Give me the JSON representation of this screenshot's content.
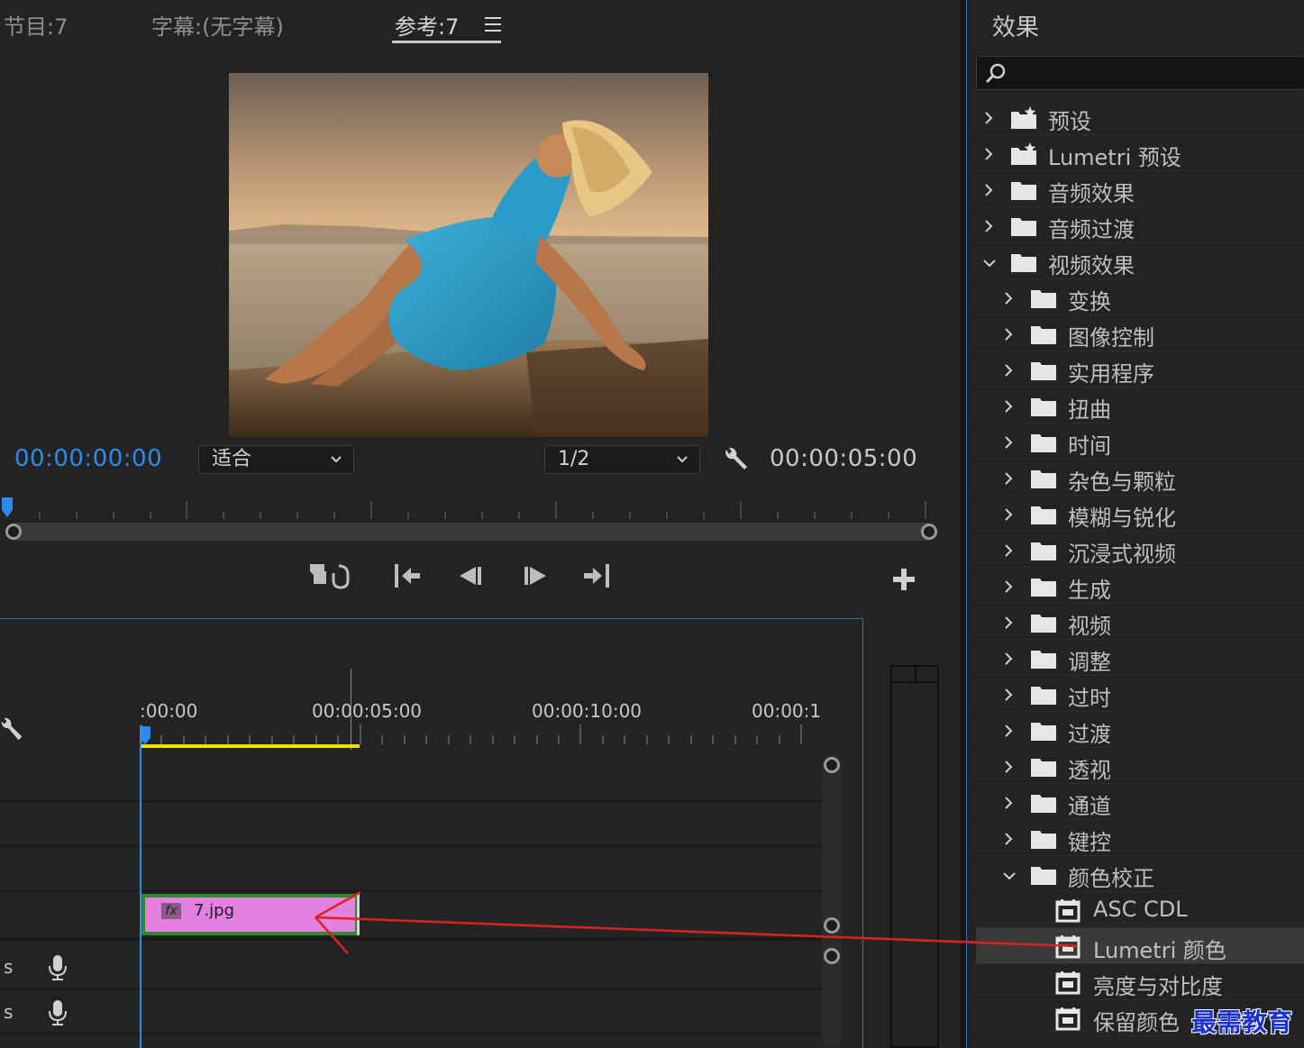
{
  "monitor": {
    "tabs": [
      {
        "label": "节目:7"
      },
      {
        "label": "字幕:(无字幕)"
      },
      {
        "label": "参考:7"
      }
    ],
    "timecode_current": "00:00:00:00",
    "timecode_duration": "00:00:05:00",
    "zoom_select": "适合",
    "resolution_select": "1/2"
  },
  "timeline": {
    "ruler_labels": [
      ":00:00",
      "00:00:05:00",
      "00:00:10:00",
      "00:00:1!"
    ],
    "clip": {
      "fx_badge": "fx",
      "name": "7.jpg"
    },
    "audio_labels": [
      "s",
      "s"
    ]
  },
  "effects": {
    "title": "效果",
    "search_placeholder": "",
    "items": [
      {
        "label": "预设",
        "level": 0,
        "type": "preset-folder",
        "expanded": false
      },
      {
        "label": "Lumetri 预设",
        "level": 0,
        "type": "preset-folder",
        "expanded": false
      },
      {
        "label": "音频效果",
        "level": 0,
        "type": "folder",
        "expanded": false
      },
      {
        "label": "音频过渡",
        "level": 0,
        "type": "folder",
        "expanded": false
      },
      {
        "label": "视频效果",
        "level": 0,
        "type": "folder",
        "expanded": true
      },
      {
        "label": "变换",
        "level": 1,
        "type": "folder",
        "expanded": false
      },
      {
        "label": "图像控制",
        "level": 1,
        "type": "folder",
        "expanded": false
      },
      {
        "label": "实用程序",
        "level": 1,
        "type": "folder",
        "expanded": false
      },
      {
        "label": "扭曲",
        "level": 1,
        "type": "folder",
        "expanded": false
      },
      {
        "label": "时间",
        "level": 1,
        "type": "folder",
        "expanded": false
      },
      {
        "label": "杂色与颗粒",
        "level": 1,
        "type": "folder",
        "expanded": false
      },
      {
        "label": "模糊与锐化",
        "level": 1,
        "type": "folder",
        "expanded": false
      },
      {
        "label": "沉浸式视频",
        "level": 1,
        "type": "folder",
        "expanded": false
      },
      {
        "label": "生成",
        "level": 1,
        "type": "folder",
        "expanded": false
      },
      {
        "label": "视频",
        "level": 1,
        "type": "folder",
        "expanded": false
      },
      {
        "label": "调整",
        "level": 1,
        "type": "folder",
        "expanded": false
      },
      {
        "label": "过时",
        "level": 1,
        "type": "folder",
        "expanded": false
      },
      {
        "label": "过渡",
        "level": 1,
        "type": "folder",
        "expanded": false
      },
      {
        "label": "透视",
        "level": 1,
        "type": "folder",
        "expanded": false
      },
      {
        "label": "通道",
        "level": 1,
        "type": "folder",
        "expanded": false
      },
      {
        "label": "键控",
        "level": 1,
        "type": "folder",
        "expanded": false
      },
      {
        "label": "颜色校正",
        "level": 1,
        "type": "folder",
        "expanded": true
      },
      {
        "label": "ASC CDL",
        "level": 2,
        "type": "effect"
      },
      {
        "label": "Lumetri 颜色",
        "level": 2,
        "type": "effect",
        "selected": true
      },
      {
        "label": "亮度与对比度",
        "level": 2,
        "type": "effect"
      },
      {
        "label": "保留颜色",
        "level": 2,
        "type": "effect"
      }
    ]
  },
  "watermark": "最需教育",
  "colors": {
    "accent_blue": "#2d8ceb",
    "clip_pink": "#e480e0",
    "clip_border": "#2d8a2d",
    "work_area": "#f0e000",
    "annotation_red": "#e02020"
  }
}
